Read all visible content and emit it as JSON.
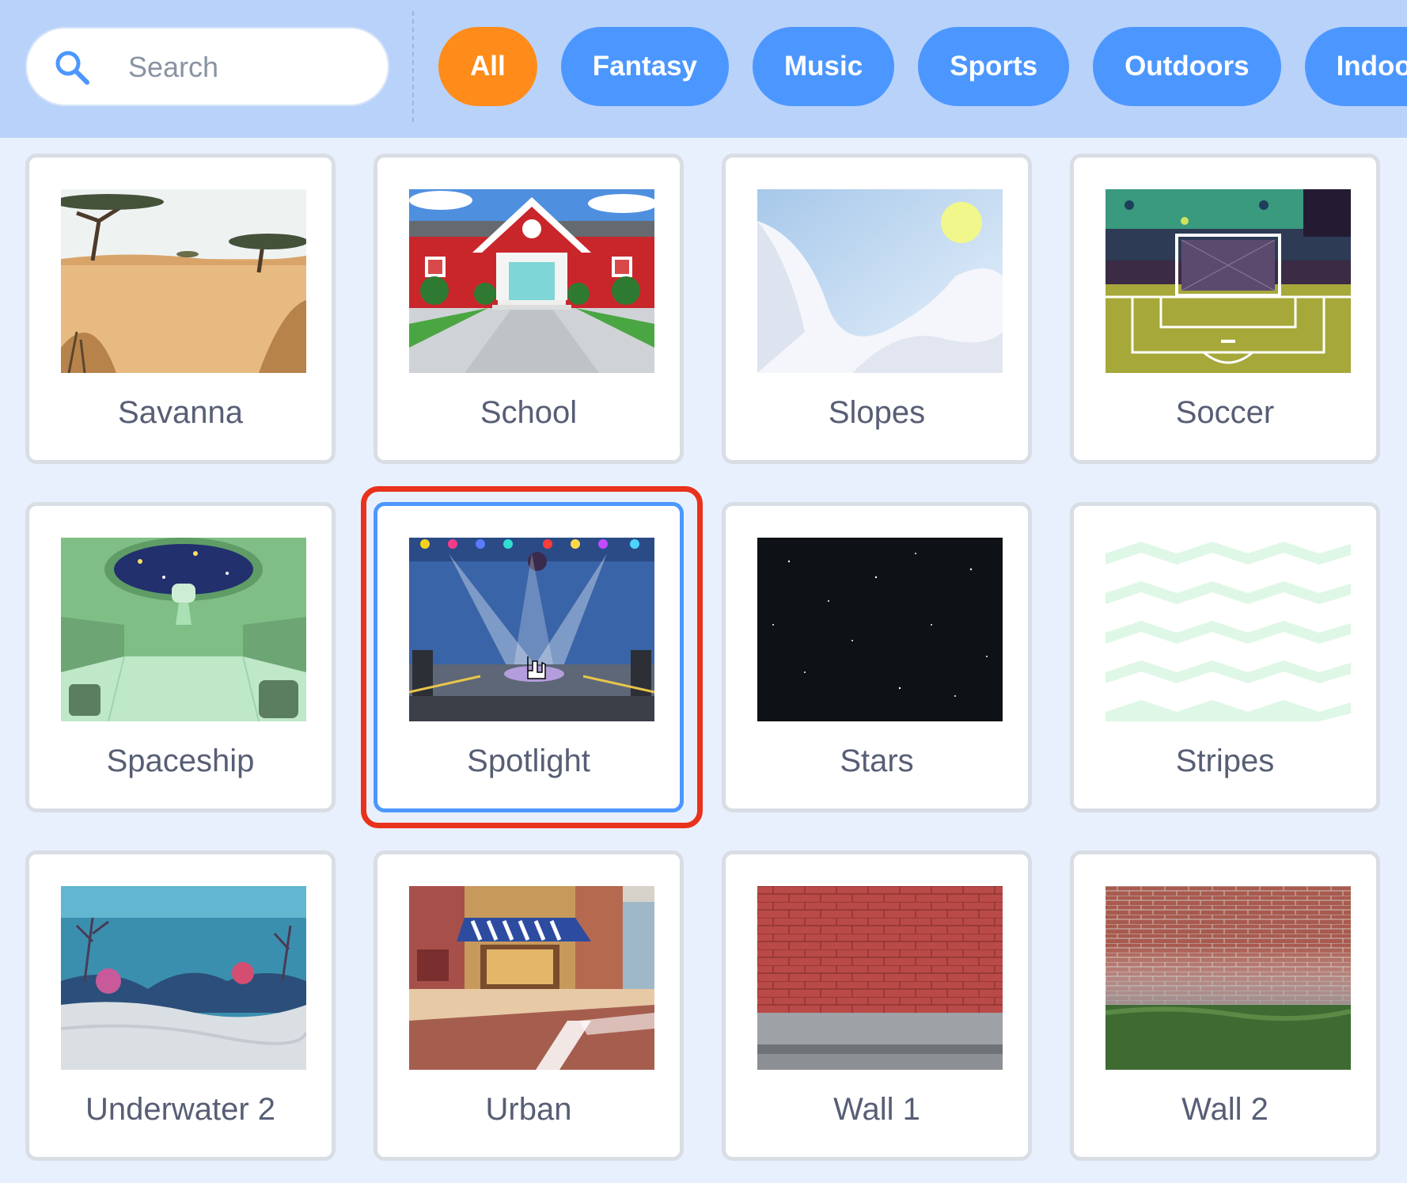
{
  "search": {
    "placeholder": "Search",
    "icon": "search-icon"
  },
  "categories": [
    {
      "label": "All",
      "active": true
    },
    {
      "label": "Fantasy",
      "active": false
    },
    {
      "label": "Music",
      "active": false
    },
    {
      "label": "Sports",
      "active": false
    },
    {
      "label": "Outdoors",
      "active": false
    },
    {
      "label": "Indoors",
      "active": false
    }
  ],
  "colors": {
    "header_bg": "#b9d2fa",
    "page_bg": "#e9f0fd",
    "pill_blue": "#4c97ff",
    "pill_active": "#ff8c1a",
    "selected_border": "#4c97ff",
    "highlight_ring": "#e8321c",
    "label_text": "#575e75"
  },
  "backdrops": [
    {
      "name": "Savanna",
      "selected": false
    },
    {
      "name": "School",
      "selected": false
    },
    {
      "name": "Slopes",
      "selected": false
    },
    {
      "name": "Soccer",
      "selected": false
    },
    {
      "name": "Spaceship",
      "selected": false
    },
    {
      "name": "Spotlight",
      "selected": true
    },
    {
      "name": "Stars",
      "selected": false
    },
    {
      "name": "Stripes",
      "selected": false
    },
    {
      "name": "Underwater 2",
      "selected": false
    },
    {
      "name": "Urban",
      "selected": false
    },
    {
      "name": "Wall 1",
      "selected": false
    },
    {
      "name": "Wall 2",
      "selected": false
    }
  ]
}
